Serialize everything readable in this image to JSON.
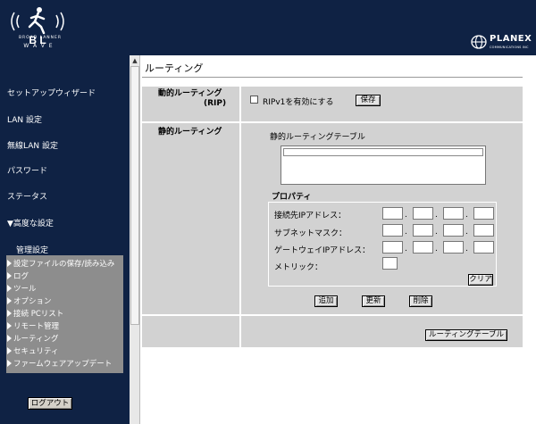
{
  "brand": {
    "logo_line": "BROAD LANNER",
    "logo_wave": "WAVE",
    "planex_name": "PLANEX",
    "planex_sub": "COMMUNICATIONS INC"
  },
  "sidebar": {
    "items": [
      {
        "label": "セットアップウィザード"
      },
      {
        "label": "LAN 設定"
      },
      {
        "label": "無線LAN 設定"
      },
      {
        "label": "パスワード"
      },
      {
        "label": "ステータス"
      },
      {
        "label": "▼高度な設定"
      }
    ],
    "submenu_title": "管理設定",
    "submenu": [
      {
        "label": "設定ファイルの保存/読み込み"
      },
      {
        "label": "ログ"
      },
      {
        "label": "ツール"
      },
      {
        "label": "オプション"
      },
      {
        "label": "接続 PCリスト"
      },
      {
        "label": "リモート管理"
      },
      {
        "label": "ルーティング"
      },
      {
        "label": "セキュリティ"
      },
      {
        "label": "ファームウェアアップデート"
      }
    ],
    "logout": "ログアウト"
  },
  "page": {
    "title": "ルーティング"
  },
  "dynamic": {
    "label_line1": "動的ルーティング",
    "label_line2": "(RIP)",
    "checkbox_label": "RIPv1を有効にする",
    "save": "保存"
  },
  "static": {
    "label": "静的ルーティング",
    "table_title": "静的ルーティングテーブル",
    "properties_title": "プロパティ",
    "fields": {
      "dest_ip": "接続先IPアドレス：",
      "subnet": "サブネットマスク：",
      "gateway": "ゲートウェイIPアドレス：",
      "metric": "メトリック："
    },
    "clear": "クリア",
    "add": "追加",
    "update": "更新",
    "delete": "削除"
  },
  "footer": {
    "routing_table": "ルーティングテーブル"
  }
}
